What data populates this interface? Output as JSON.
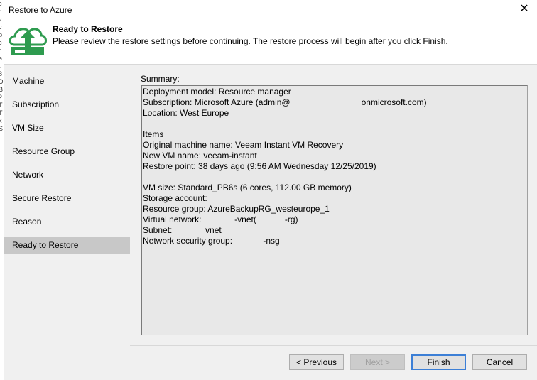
{
  "window": {
    "title": "Restore to Azure",
    "close_glyph": "✕"
  },
  "left_edge_fragments": [
    "c",
    "t",
    "v",
    "c",
    "b",
    "c",
    "r",
    "a",
    "t",
    "8",
    "D",
    "B",
    "2",
    "T",
    "T",
    "k",
    "S"
  ],
  "header": {
    "title": "Ready to Restore",
    "description": "Please review the restore settings before continuing. The restore process will begin after you click Finish.",
    "icon": "cloud-upload-icon",
    "accent_color": "#2e9b4f"
  },
  "nav": {
    "items": [
      {
        "label": "Machine"
      },
      {
        "label": "Subscription"
      },
      {
        "label": "VM Size"
      },
      {
        "label": "Resource Group"
      },
      {
        "label": "Network"
      },
      {
        "label": "Secure Restore"
      },
      {
        "label": "Reason"
      },
      {
        "label": "Ready to Restore",
        "active": true
      }
    ]
  },
  "summary": {
    "label": "Summary:",
    "lines": [
      "Deployment model: Resource manager",
      "Subscription: Microsoft Azure (admin@                              onmicrosoft.com)",
      "Location: West Europe",
      "",
      "Items",
      "Original machine name: Veeam Instant VM Recovery",
      "New VM name: veeam-instant",
      "Restore point: 38 days ago (9:56 AM Wednesday 12/25/2019)",
      "",
      "VM size: Standard_PB6s (6 cores, 112.00 GB memory)",
      "Storage account:",
      "Resource group: AzureBackupRG_westeurope_1",
      "Virtual network:              -vnet(            -rg)",
      "Subnet:              vnet",
      "Network security group:             -nsg"
    ]
  },
  "buttons": {
    "previous": "< Previous",
    "next": "Next >",
    "finish": "Finish",
    "cancel": "Cancel"
  }
}
